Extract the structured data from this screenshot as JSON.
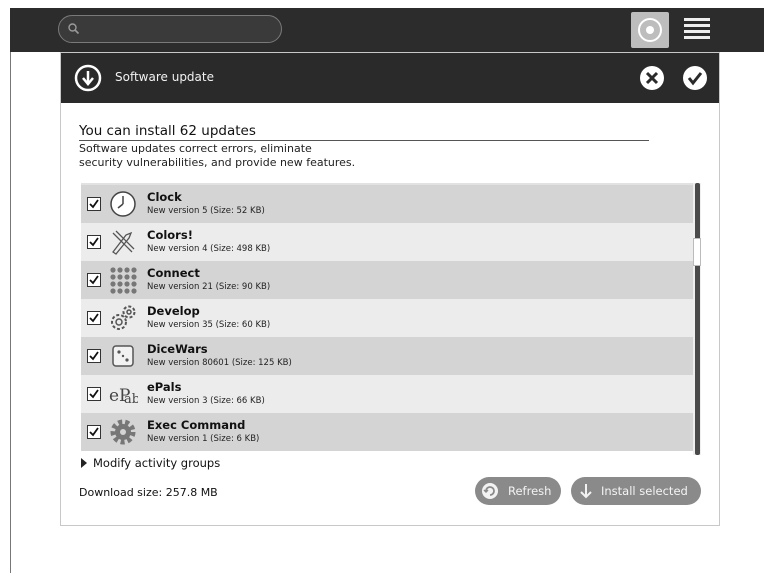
{
  "toolbar": {
    "search_placeholder": "",
    "icons": [
      "search-icon",
      "home-view-icon",
      "list-view-icon"
    ]
  },
  "dialog": {
    "title": "Software update",
    "heading": "You can install 62 updates",
    "description_line1": "Software updates correct errors, eliminate",
    "description_line2": "security vulnerabilities, and provide new features.",
    "updates": [
      {
        "name": "Clock",
        "version": "New version 5 (Size: 52 KB)",
        "icon": "clock-icon",
        "checked": true
      },
      {
        "name": "Colors!",
        "version": "New version 4 (Size: 498 KB)",
        "icon": "colors-icon",
        "checked": true
      },
      {
        "name": "Connect",
        "version": "New version 21 (Size: 90 KB)",
        "icon": "connect-icon",
        "checked": true
      },
      {
        "name": "Develop",
        "version": "New version 35 (Size: 60 KB)",
        "icon": "develop-icon",
        "checked": true
      },
      {
        "name": "DiceWars",
        "version": "New version 80601 (Size: 125 KB)",
        "icon": "dice-icon",
        "checked": true
      },
      {
        "name": "ePals",
        "version": "New version 3 (Size: 66 KB)",
        "icon": "epals-icon",
        "checked": true
      },
      {
        "name": "Exec Command",
        "version": "New version 1 (Size: 6 KB)",
        "icon": "gear-icon",
        "checked": true
      }
    ],
    "modify_label": "Modify activity groups",
    "download_size": "Download size: 257.8 MB",
    "refresh_label": "Refresh",
    "install_label": "Install selected"
  }
}
